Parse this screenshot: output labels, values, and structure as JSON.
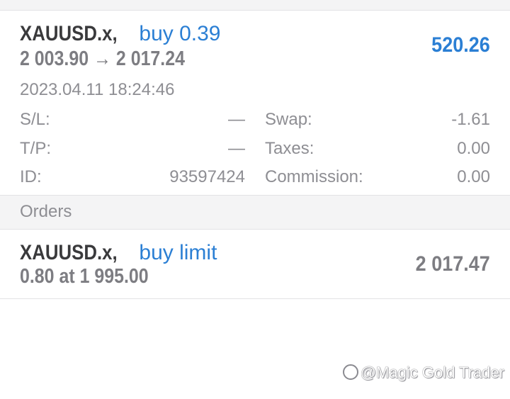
{
  "position": {
    "symbol": "XAUUSD.x,",
    "direction": "buy 0.39",
    "open_price": "2 003.90",
    "arrow": "→",
    "current_price": "2 017.24",
    "profit": "520.26",
    "time": "2023.04.11 18:24:46",
    "details": {
      "sl_label": "S/L:",
      "sl_value": "—",
      "tp_label": "T/P:",
      "tp_value": "—",
      "id_label": "ID:",
      "id_value": "93597424",
      "swap_label": "Swap:",
      "swap_value": "-1.61",
      "taxes_label": "Taxes:",
      "taxes_value": "0.00",
      "commission_label": "Commission:",
      "commission_value": "0.00"
    }
  },
  "orders_section": {
    "title": "Orders"
  },
  "order": {
    "symbol": "XAUUSD.x,",
    "type": "buy limit",
    "volume_price": "0.80 at 1 995.00",
    "current_price": "2 017.47"
  },
  "watermark": {
    "text": "@Magic Gold Trader",
    "icon": "douyin-logo-icon"
  },
  "colors": {
    "accent": "#2b7fd4",
    "muted": "#8e8e93",
    "section_bg": "#f4f4f5"
  }
}
